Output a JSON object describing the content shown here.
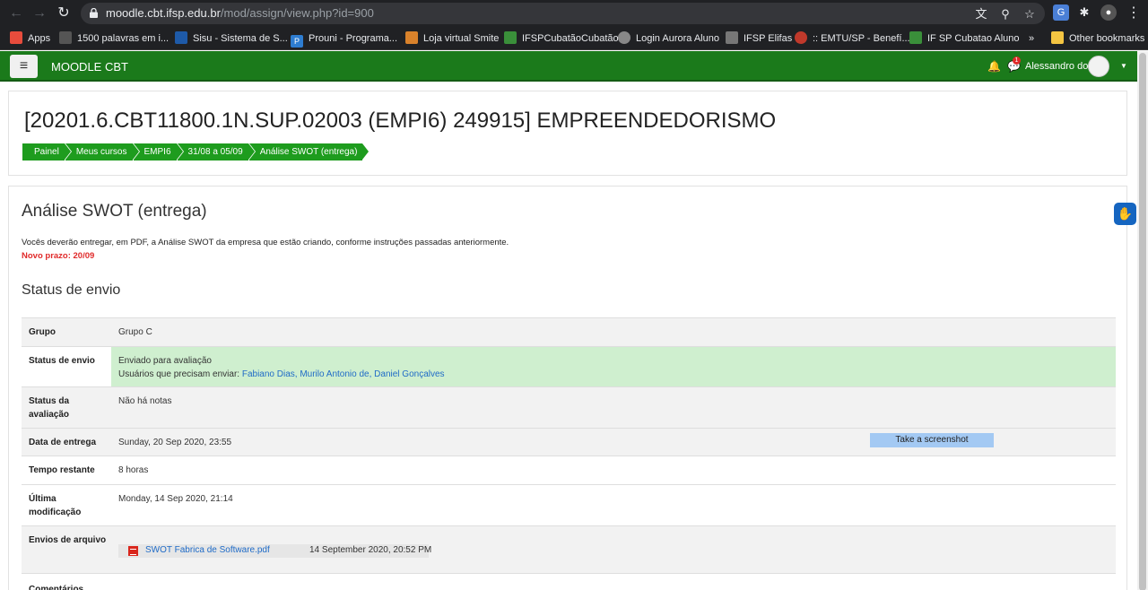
{
  "browser": {
    "url_host": "moodle.cbt.ifsp.edu.br",
    "url_path": "/mod/assign/view.php?id=900",
    "bookmarks": [
      {
        "label": "Apps",
        "icon": "apps-grid-icon",
        "color": "#e74c3c"
      },
      {
        "label": "1500 palavras em i...",
        "icon": "page-icon",
        "color": "#555555"
      },
      {
        "label": "Sisu - Sistema de S...",
        "icon": "sisu-icon",
        "color": "#1e5aa8"
      },
      {
        "label": "Prouni - Programa...",
        "icon": "prouni-icon",
        "color": "#2e7dd1"
      },
      {
        "label": "Loja virtual Smite",
        "icon": "smite-icon",
        "color": "#d9822b"
      },
      {
        "label": "IFSPCubatãoCubatão",
        "icon": "ifsp-icon",
        "color": "#3a8f3a"
      },
      {
        "label": "Login Aurora Aluno",
        "icon": "globe-icon",
        "color": "#888888"
      },
      {
        "label": "IFSP Elifas",
        "icon": "ifsp-elifas-icon",
        "color": "#777777"
      },
      {
        "label": ":: EMTU/SP - Benefí...",
        "icon": "emtu-icon",
        "color": "#c0392b"
      },
      {
        "label": "IF SP Cubatao Aluno",
        "icon": "ifsp-aluno-icon",
        "color": "#3a8f3a"
      }
    ],
    "more": "»",
    "other_bookmarks": "Other bookmarks"
  },
  "navbar": {
    "menu_glyph": "≡",
    "brand": "MOODLE CBT",
    "user_name": "Alessandro dos",
    "notification_count": "1"
  },
  "header": {
    "course_title": "[20201.6.CBT11800.1N.SUP.02003 (EMPI6) 249915] EMPREENDEDORISMO",
    "breadcrumbs": [
      "Painel",
      "Meus cursos",
      "EMPI6",
      "31/08 a 05/09",
      "Análise SWOT (entrega)"
    ]
  },
  "assignment": {
    "title": "Análise SWOT (entrega)",
    "description": "Vocês deverão entregar, em PDF, a Análise SWOT da empresa que estão criando, conforme instruções passadas anteriormente.",
    "deadline_note": "Novo prazo: 20/09",
    "status_heading": "Status de envio"
  },
  "status": {
    "group_label": "Grupo",
    "group_value": "Grupo C",
    "submission_label": "Status de envio",
    "submission_value": "Enviado para avaliação",
    "pending_prefix": "Usuários que precisam enviar:",
    "pending_users": [
      "Fabiano Dias,",
      "Murilo Antonio de,",
      "Daniel Gonçalves"
    ],
    "grading_label_1": "Status da",
    "grading_label_2": "avaliação",
    "grading_value": "Não há notas",
    "due_label": "Data de entrega",
    "due_value": "Sunday, 20 Sep 2020, 23:55",
    "screenshot_button": "Take a screenshot",
    "remaining_label": "Tempo restante",
    "remaining_value": "8 horas",
    "modified_label_1": "Última",
    "modified_label_2": "modificação",
    "modified_value": "Monday, 14 Sep 2020, 21:14",
    "files_label": "Envios de arquivo",
    "file_name": "SWOT Fabrica de Software.pdf",
    "file_date": "14 September 2020, 20:52 PM",
    "comments_label": "Comentários"
  }
}
